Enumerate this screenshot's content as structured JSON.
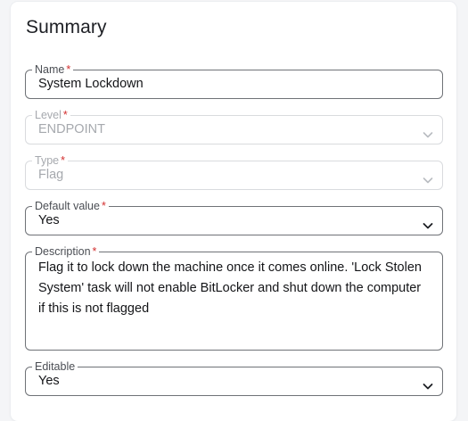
{
  "panel": {
    "title": "Summary"
  },
  "fields": {
    "name": {
      "label": "Name",
      "required": "*",
      "value": "System Lockdown"
    },
    "level": {
      "label": "Level",
      "required": "*",
      "value": "ENDPOINT"
    },
    "type": {
      "label": "Type",
      "required": "*",
      "value": "Flag"
    },
    "default_value": {
      "label": "Default value",
      "required": "*",
      "value": "Yes"
    },
    "description": {
      "label": "Description",
      "required": "*",
      "value": "Flag it to lock down the machine once it comes online. 'Lock Stolen System' task will not enable BitLocker and shut down the computer if this is not flagged"
    },
    "editable": {
      "label": "Editable",
      "value": "Yes"
    }
  },
  "colors": {
    "required_star": "#d32f2f",
    "border_active": "#6f7277",
    "border_disabled": "#d9dbde",
    "text_disabled": "#a6a9ae"
  },
  "icons": {
    "dropdown": "chevron-down-icon"
  }
}
